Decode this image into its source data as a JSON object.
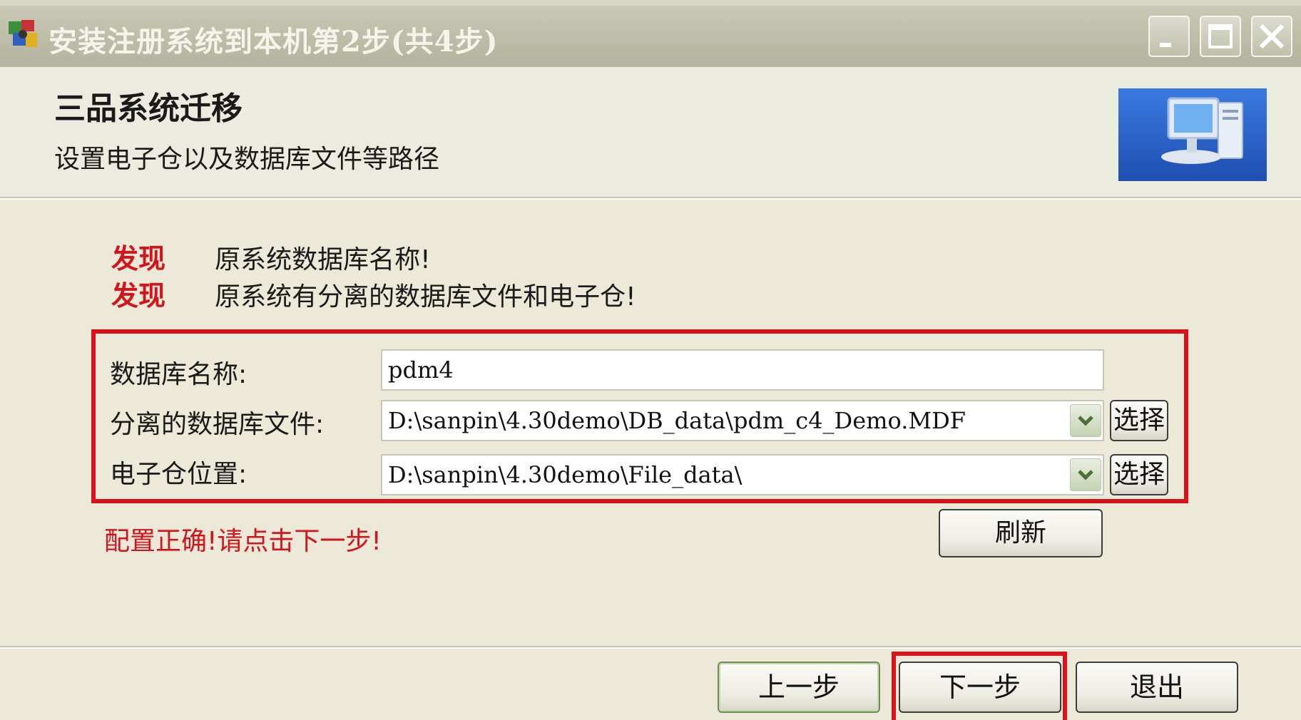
{
  "window": {
    "title": "安装注册系统到本机第2步(共4步)"
  },
  "header": {
    "title": "三品系统迁移",
    "subtitle": "设置电子仓以及数据库文件等路径"
  },
  "messages": [
    {
      "tag": "发现",
      "text": "原系统数据库名称!"
    },
    {
      "tag": "发现",
      "text": "原系统有分离的数据库文件和电子仓!"
    }
  ],
  "form": {
    "db_name": {
      "label": "数据库名称:",
      "value": "pdm4"
    },
    "db_file": {
      "label": "分离的数据库文件:",
      "value": "D:\\sanpin\\4.30demo\\DB_data\\pdm_c4_Demo.MDF",
      "button": "选择"
    },
    "vault": {
      "label": "电子仓位置:",
      "value": "D:\\sanpin\\4.30demo\\File_data\\",
      "button": "选择"
    }
  },
  "status": "配置正确!请点击下一步!",
  "buttons": {
    "refresh": "刷新",
    "prev": "上一步",
    "next": "下一步",
    "exit": "退出"
  },
  "colors": {
    "highlight": "#d8131b",
    "alert_text": "#d4141c",
    "window_bg": "#ece9d8"
  }
}
